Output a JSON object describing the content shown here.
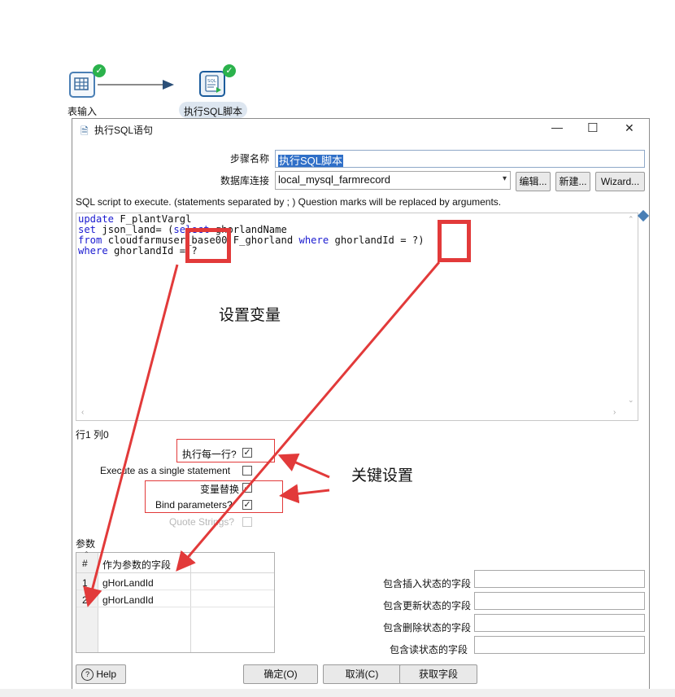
{
  "canvas": {
    "step1": {
      "label": "表输入",
      "icon": "table-input-icon"
    },
    "step2": {
      "label": "执行SQL脚本",
      "icon": "sql-script-icon"
    }
  },
  "dialog": {
    "title": "执行SQL语句",
    "title_icon": "sql-doc-icon",
    "controls": {
      "minimize": "—",
      "maximize": "☐",
      "close": "✕"
    },
    "step_name_label": "步骤名称",
    "step_name_value": "执行SQL脚本",
    "db_conn_label": "数据库连接",
    "db_conn_value": "local_mysql_farmrecord",
    "edit_btn": "编辑...",
    "new_btn": "新建...",
    "wizard_btn": "Wizard...",
    "sql_hint": "SQL script to execute. (statements separated by ; ) Question marks will be replaced by arguments.",
    "sql_lines": [
      {
        "kw": "update",
        "rest": " F_plantVargl"
      },
      {
        "kw": "set",
        "rest": " json_land= (",
        "kw2": "select",
        "rest2": " ghorlandName"
      },
      {
        "kw": "from",
        "rest": " cloudfarmuser_base00.F_ghorland ",
        "kw2": "where",
        "rest2": " ghorlandId = ?)"
      },
      {
        "kw": "where",
        "rest": " ghorlandId = ?"
      }
    ],
    "cursor_pos": "行1 列0",
    "options": {
      "each_row": {
        "label": "执行每一行?",
        "checked": true
      },
      "single_statement": {
        "label": "Execute as a single statement",
        "checked": false
      },
      "var_substitution": {
        "label": "变量替换",
        "checked": true
      },
      "bind_params": {
        "label": "Bind parameters?",
        "checked": true
      },
      "quote_strings": {
        "label": "Quote Strings?",
        "checked": false
      }
    },
    "params_label": "参数",
    "params_table": {
      "headers": [
        "#",
        "作为参数的字段"
      ],
      "rows": [
        {
          "num": "1",
          "field": "gHorLandId"
        },
        {
          "num": "2",
          "field": "gHorLandId"
        }
      ]
    },
    "status_fields": {
      "insert_label": "包含插入状态的字段",
      "update_label": "包含更新状态的字段",
      "delete_label": "包含删除状态的字段",
      "read_label": "包含读状态的字段"
    },
    "help_btn": "Help",
    "ok_btn": "确定(O)",
    "cancel_btn": "取消(C)",
    "get_fields_btn": "获取字段"
  },
  "annotations": {
    "set_variable": "设置变量",
    "key_settings": "关键设置",
    "color": "#e23a3a"
  }
}
